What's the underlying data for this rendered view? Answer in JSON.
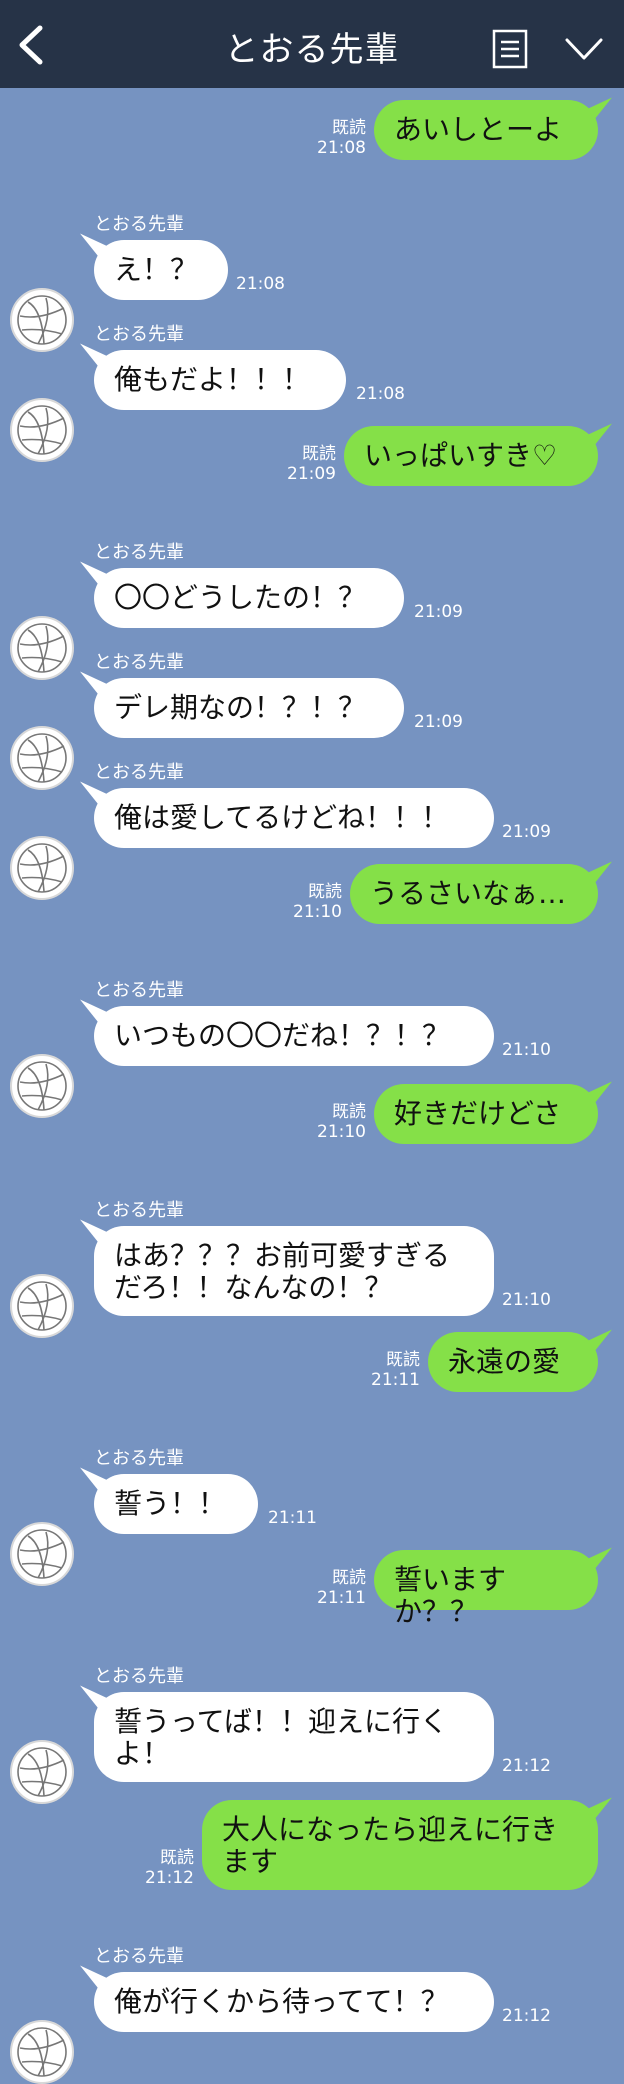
{
  "header": {
    "title": "とおる先輩"
  },
  "read_label": "既読",
  "sender_name": "とおる先輩",
  "messages": [
    {
      "side": "out",
      "text": "あいしとーよ",
      "time": "21:08"
    },
    {
      "side": "in",
      "text": "え！？",
      "time": "21:08"
    },
    {
      "side": "in",
      "text": "俺もだよ！！！",
      "time": "21:08"
    },
    {
      "side": "out",
      "text": "いっぱいすき♡",
      "time": "21:09"
    },
    {
      "side": "in",
      "text": "〇〇どうしたの！？",
      "time": "21:09"
    },
    {
      "side": "in",
      "text": "デレ期なの！？！？",
      "time": "21:09"
    },
    {
      "side": "in",
      "text": "俺は愛してるけどね！！！",
      "time": "21:09"
    },
    {
      "side": "out",
      "text": "うるさいなぁ…",
      "time": "21:10"
    },
    {
      "side": "in",
      "text": "いつもの〇〇だね！？！？",
      "time": "21:10"
    },
    {
      "side": "out",
      "text": "好きだけどさ",
      "time": "21:10"
    },
    {
      "side": "in",
      "text": "はあ？？？お前可愛すぎるだろ！！なんなの！？",
      "time": "21:10"
    },
    {
      "side": "out",
      "text": "永遠の愛",
      "time": "21:11"
    },
    {
      "side": "in",
      "text": "誓う！！",
      "time": "21:11"
    },
    {
      "side": "out",
      "text": "誓いますか？？",
      "time": "21:11"
    },
    {
      "side": "in",
      "text": "誓うってば！！迎えに行くよ！",
      "time": "21:12"
    },
    {
      "side": "out",
      "text": "大人になったら迎えに行きます",
      "time": "21:12"
    },
    {
      "side": "in",
      "text": "俺が行くから待ってて！？",
      "time": "21:12"
    }
  ],
  "icons": {
    "back": "chevron-left-icon",
    "menu": "menu-list-icon",
    "collapse": "chevron-down-icon",
    "avatar": "volleyball-icon"
  },
  "colors": {
    "header": "#263347",
    "background": "#7693c1",
    "outgoing": "#85e048",
    "incoming": "#ffffff"
  }
}
